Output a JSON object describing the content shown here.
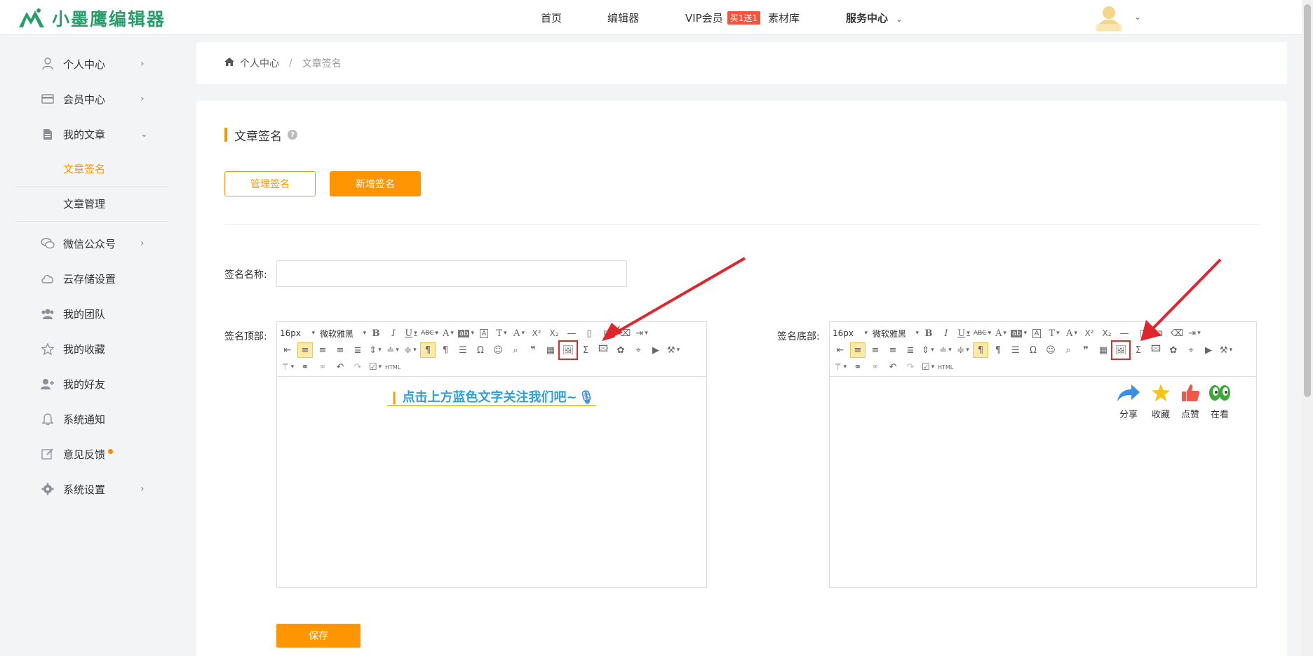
{
  "brand": {
    "name": "小墨鹰编辑器",
    "color": "#2a9d6a"
  },
  "nav": {
    "home": "首页",
    "editor": "编辑器",
    "vip": "VIP会员",
    "vip_badge": "买1送1",
    "materials": "素材库",
    "service": "服务中心"
  },
  "sidebar": {
    "items": [
      {
        "label": "个人中心",
        "icon": "user-icon"
      },
      {
        "label": "会员中心",
        "icon": "card-icon"
      },
      {
        "label": "我的文章",
        "icon": "document-icon"
      },
      {
        "label": "文章签名",
        "icon": ""
      },
      {
        "label": "文章管理",
        "icon": ""
      },
      {
        "label": "微信公众号",
        "icon": "wechat-icon"
      },
      {
        "label": "云存储设置",
        "icon": "cloud-icon"
      },
      {
        "label": "我的团队",
        "icon": "team-icon"
      },
      {
        "label": "我的收藏",
        "icon": "star-icon"
      },
      {
        "label": "我的好友",
        "icon": "add-friend-icon"
      },
      {
        "label": "系统通知",
        "icon": "bell-icon"
      },
      {
        "label": "意见反馈",
        "icon": "edit-icon"
      },
      {
        "label": "系统设置",
        "icon": "gear-icon"
      }
    ],
    "active_color": "#ff9500"
  },
  "breadcrumb": {
    "home": "个人中心",
    "separator": "/",
    "current": "文章签名"
  },
  "section": {
    "title": "文章签名"
  },
  "buttons": {
    "manage": "管理签名",
    "add": "新增签名",
    "save": "保存"
  },
  "form": {
    "name_label": "签名名称:",
    "name_value": "",
    "top_label": "签名顶部:",
    "bottom_label": "签名底部:"
  },
  "editor": {
    "font_size": "16px",
    "font_family": "微软雅黑",
    "html_label": "HTML"
  },
  "top_editor_content": {
    "text": "点击上方蓝色文字关注我们吧~"
  },
  "bottom_editor_content": {
    "actions": [
      {
        "label": "分享",
        "icon": "share-icon",
        "color": "#3a8ee6"
      },
      {
        "label": "收藏",
        "icon": "star-icon",
        "color": "#f5c518"
      },
      {
        "label": "点赞",
        "icon": "thumbs-up-icon",
        "color": "#f2584a"
      },
      {
        "label": "在看",
        "icon": "eyes-icon",
        "color": "#3aa83a"
      }
    ]
  },
  "colors": {
    "accent": "#ff9500",
    "annotation": "#e0262c"
  }
}
